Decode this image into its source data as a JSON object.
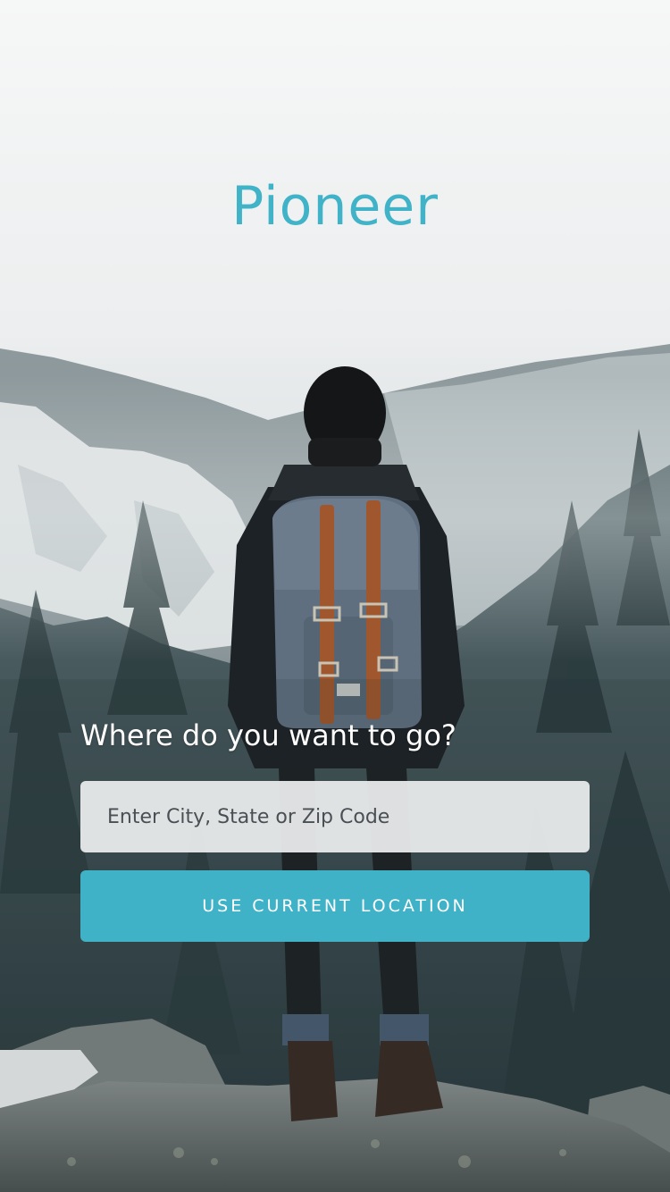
{
  "app": {
    "title": "Pioneer",
    "brand_color": "#41b3c8"
  },
  "background": {
    "icon": "hiker-mountain-photo"
  },
  "search": {
    "prompt": "Where do you want to go?",
    "placeholder": "Enter City, State or Zip Code",
    "value": ""
  },
  "actions": {
    "use_location_label": "USE CURRENT LOCATION"
  }
}
